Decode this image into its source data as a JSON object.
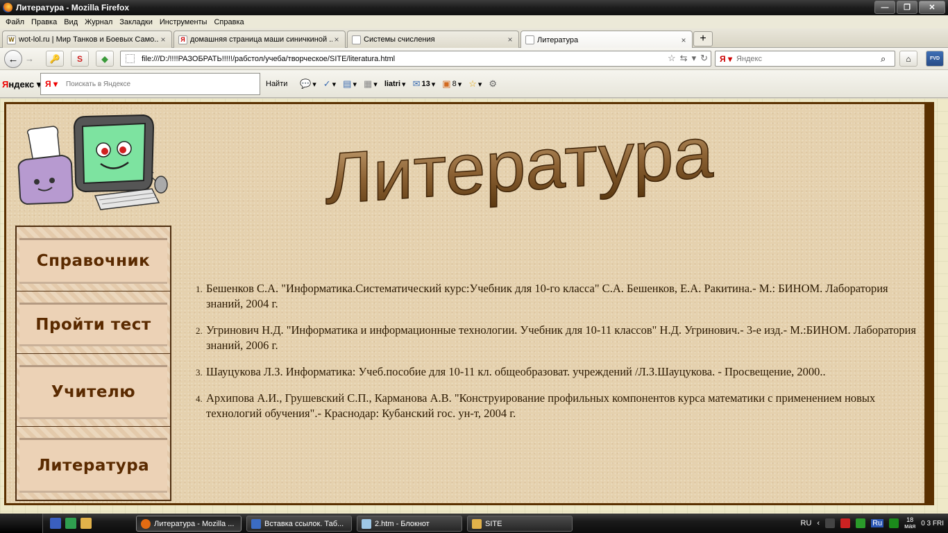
{
  "window": {
    "title": "Литература - Mozilla Firefox",
    "buttons": {
      "minimize": "—",
      "maximize": "❐",
      "close": "✕"
    }
  },
  "menubar": [
    "Файл",
    "Правка",
    "Вид",
    "Журнал",
    "Закладки",
    "Инструменты",
    "Справка"
  ],
  "tabs": [
    {
      "title": "wot-lol.ru | Мир Танков и Боевых Само...",
      "icon": "tank-favicon"
    },
    {
      "title": "домашняя страница маши синичкиной ...",
      "icon": "yandex-favicon"
    },
    {
      "title": "Системы счисления",
      "icon": "blank-page-favicon"
    },
    {
      "title": "Литература",
      "icon": "blank-page-favicon",
      "active": true
    }
  ],
  "navbar": {
    "url": "file:///D:/!!!!РАЗОБРАТЬ!!!!!/рабстол/учеба/творческое/SITE/literatura.html",
    "search_placeholder": "Яндекс",
    "s_button": "S",
    "fvd_label": "FVD"
  },
  "yandex_bar": {
    "logo_red": "Я",
    "logo_rest": "ндекс",
    "search_placeholder": "Поискать в Яндексе",
    "find_label": "Найти",
    "user": "liatri",
    "mail_count": "13",
    "other_count": "8"
  },
  "page": {
    "heading": "Литература",
    "menu": [
      "Справочник",
      "Пройти тест",
      "Учителю",
      "Литература"
    ],
    "bibliography": [
      "Бешенков С.А. \"Информатика.Систематический курс:Учебник для 10-го класса\" С.А. Бешенков, Е.А. Ракитина.- М.: БИНОМ. Лаборатория знаний, 2004 г.",
      "Угринович Н.Д. \"Информатика и информационные технологии. Учебник для 10-11 классов\" Н.Д. Угринович.- 3-е изд.- М.:БИНОМ. Лаборатория знаний, 2006 г.",
      "Шауцукова Л.З. Информатика: Учеб.пособие для 10-11 кл. общеобразоват. учреждений /Л.З.Шауцукова. - Просвещение, 2000..",
      "Архипова А.И., Грушевский С.П., Карманова А.В. \"Конструирование профильных компонентов курса математики с применением новых технологий обучения\".- Краснодар: Кубанский гос. ун-т, 2004 г."
    ]
  },
  "taskbar": {
    "tasks": [
      {
        "title": "Литература - Mozilla ...",
        "active": true
      },
      {
        "title": "Вставка ссылок. Таб..."
      },
      {
        "title": "2.htm - Блокнот"
      },
      {
        "title": "SITE"
      }
    ],
    "lang": "RU",
    "tray_lang": "Ru",
    "clock_day": "18",
    "clock_month": "мая",
    "clock_time": "0 3 FRI"
  },
  "colors": {
    "page_bg": "#e5d1ae",
    "frame": "#5a3000",
    "menu_text": "#5a2a00",
    "body_text": "#2a1800"
  }
}
